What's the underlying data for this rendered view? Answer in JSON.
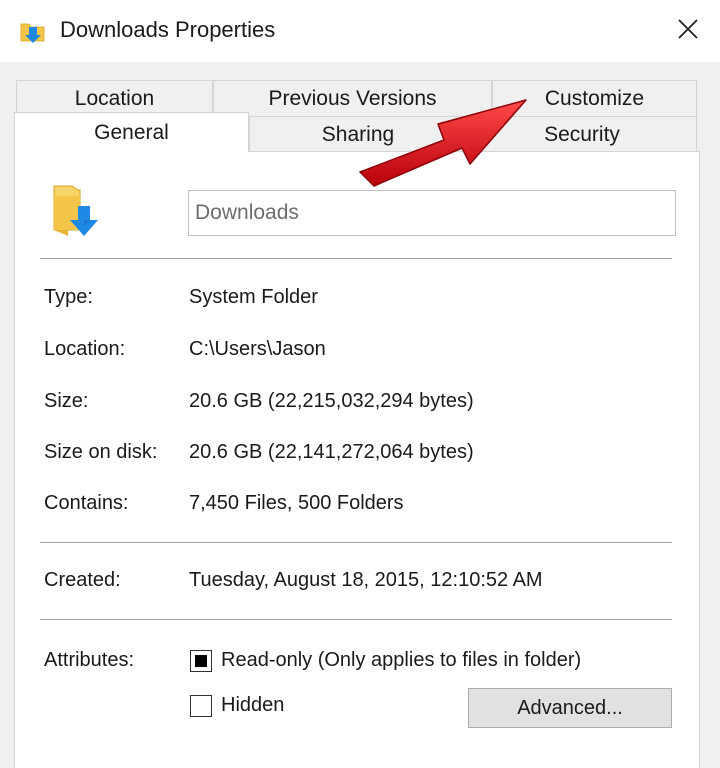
{
  "window": {
    "title": "Downloads Properties",
    "title_icon": "folder-download-icon",
    "close_icon": "close-icon"
  },
  "tabs": {
    "row1": [
      {
        "label": "Location"
      },
      {
        "label": "Previous Versions"
      },
      {
        "label": "Customize"
      }
    ],
    "row2": [
      {
        "label": "General",
        "active": true
      },
      {
        "label": "Sharing"
      },
      {
        "label": "Security"
      }
    ]
  },
  "general": {
    "folder_icon": "downloads-folder-icon",
    "name_value": "Downloads",
    "fields": [
      {
        "label": "Type:",
        "value": "System Folder"
      },
      {
        "label": "Location:",
        "value": "C:\\Users\\Jason"
      },
      {
        "label": "Size:",
        "value": "20.6 GB (22,215,032,294 bytes)"
      },
      {
        "label": "Size on disk:",
        "value": "20.6 GB (22,141,272,064 bytes)"
      },
      {
        "label": "Contains:",
        "value": "7,450 Files, 500 Folders"
      }
    ],
    "created": {
      "label": "Created:",
      "value": "Tuesday, August 18, 2015, 12:10:52 AM"
    },
    "attributes": {
      "label": "Attributes:",
      "readonly": {
        "label": "Read-only (Only applies to files in folder)",
        "state": "indeterminate"
      },
      "hidden": {
        "label": "Hidden",
        "checked": false
      },
      "advanced_button": "Advanced..."
    }
  },
  "annotation": {
    "arrow_color": "#e8111b",
    "points_to": "Customize"
  },
  "colors": {
    "dialog_bg": "#f0f0f0",
    "panel_bg": "#ffffff",
    "folder_yellow": "#f5c54a",
    "download_blue": "#1e88e5"
  }
}
